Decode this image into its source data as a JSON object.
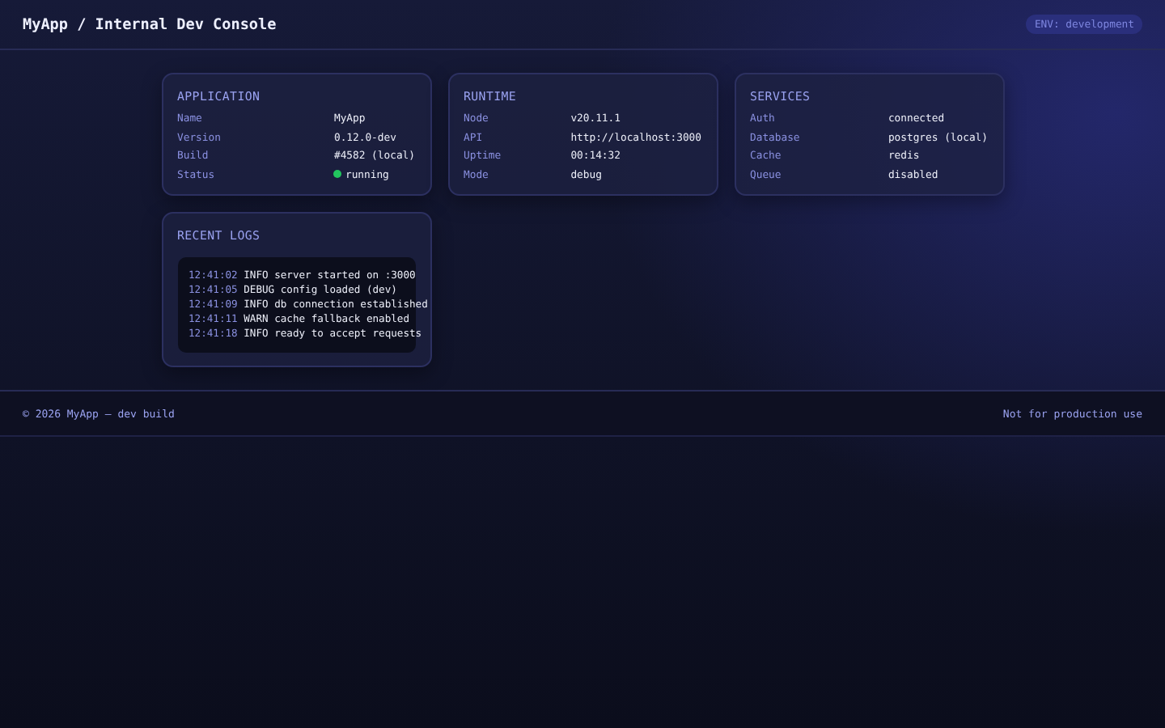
{
  "header": {
    "title": "MyApp / Internal Dev Console",
    "env_badge": "ENV: development"
  },
  "cards": [
    {
      "title": "APPLICATION",
      "rows": [
        {
          "kind": "text",
          "label": "Name",
          "value": "MyApp"
        },
        {
          "kind": "text",
          "label": "Version",
          "value": "0.12.0-dev"
        },
        {
          "kind": "text",
          "label": "Build",
          "value": "#4582 (local)"
        },
        {
          "kind": "status",
          "label": "Status",
          "value": "running",
          "color": "#22c55e"
        }
      ]
    },
    {
      "title": "RUNTIME",
      "rows": [
        {
          "kind": "text",
          "label": "Node",
          "value": "v20.11.1"
        },
        {
          "kind": "text",
          "label": "API",
          "value": "http://localhost:3000"
        },
        {
          "kind": "text",
          "label": "Uptime",
          "value": "00:14:32"
        },
        {
          "kind": "text",
          "label": "Mode",
          "value": "debug"
        }
      ]
    },
    {
      "title": "SERVICES",
      "rows": [
        {
          "kind": "text",
          "label": "Auth",
          "value": "connected"
        },
        {
          "kind": "text",
          "label": "Database",
          "value": "postgres (local)"
        },
        {
          "kind": "text",
          "label": "Cache",
          "value": "redis"
        },
        {
          "kind": "text",
          "label": "Queue",
          "value": "disabled"
        }
      ]
    }
  ],
  "logs": {
    "title": "RECENT LOGS",
    "entries": [
      {
        "time": "12:41:02",
        "message": "INFO server started on :3000"
      },
      {
        "time": "12:41:05",
        "message": "DEBUG config loaded (dev)"
      },
      {
        "time": "12:41:09",
        "message": "INFO db connection established"
      },
      {
        "time": "12:41:11",
        "message": "WARN cache fallback enabled"
      },
      {
        "time": "12:41:18",
        "message": "INFO ready to accept requests"
      }
    ]
  },
  "footer": {
    "left": "© 2026 MyApp — dev build",
    "right": "Not for production use"
  }
}
